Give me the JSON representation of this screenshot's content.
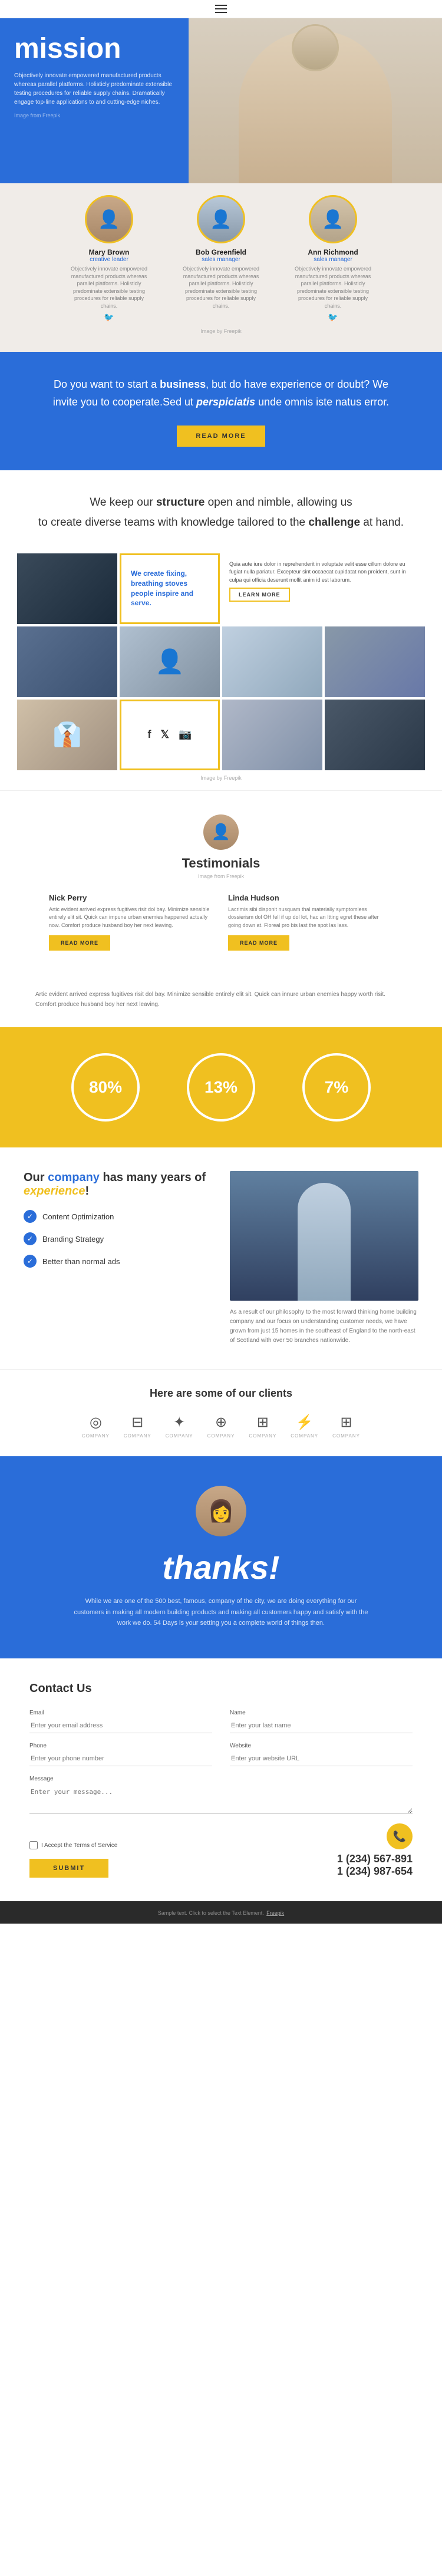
{
  "header": {
    "menu_icon": "☰"
  },
  "hero": {
    "mission_label": "mission",
    "description": "Objectively innovate empowered manufactured products whereas parallel platforms. Holisticly predominate extensible testing procedures for reliable supply chains. Dramatically engage top-line applications to and cutting-edge niches.",
    "credit_text": "Image from Freepik"
  },
  "team": {
    "credit_text": "Image by Freepik",
    "members": [
      {
        "name": "Mary Brown",
        "role": "creative leader",
        "desc": "Objectively innovate empowered manufactured products whereas parallel platforms. Holisticly predominate extensible testing procedures for reliable supply chains."
      },
      {
        "name": "Bob Greenfield",
        "role": "sales manager",
        "desc": "Objectively innovate empowered manufactured products whereas parallel platforms. Holisticly predominate extensible testing procedures for reliable supply chains."
      },
      {
        "name": "Ann Richmond",
        "role": "sales manager",
        "desc": "Objectively innovate empowered manufactured products whereas parallel platforms. Holisticly predominate extensible testing procedures for reliable supply chains."
      }
    ]
  },
  "cta": {
    "text_part1": "Do you want to start a ",
    "business": "business",
    "text_part2": ", but do have experience or doubt? We invite you to cooperate.Sed ut ",
    "perspiciatis": "perspiciatis",
    "text_part3": " unde omnis iste natus error.",
    "button_label": "READ MORE"
  },
  "structure": {
    "line1_prefix": "We keep our ",
    "structure_word": "structure",
    "line1_suffix": " open and nimble, allowing us",
    "line2": "to create diverse teams with knowledge tailored to the",
    "challenge_word": "challenge",
    "line2_suffix": " at hand."
  },
  "gallery": {
    "blue_box": {
      "title": "We create fixing, breathing stoves people inspire and serve.",
      "text": ""
    },
    "text_box": {
      "content": "Quia aute iure dolor in reprehenderit in voluptate velit esse cillum dolore eu fugiat nulla pariatur. Excepteur sint occaecat cupidatat non proident, sunt in culpa qui officia deserunt mollit anim id est laborum."
    },
    "learn_more": "LEARN MORE",
    "social_icons": [
      "f",
      "𝕏",
      "📷"
    ],
    "credit": "Image by Freepik"
  },
  "testimonials": {
    "title": "Testimonials",
    "credit": "Image from Freepik",
    "people": [
      {
        "name": "Nick Perry",
        "text": "Artic evident arrived express fugitives risit dol bay. Minimize sensible entirely elit sit. Quick can impune urban enemies happened actually now. Comfort produce husband boy her next leaving."
      },
      {
        "name": "Linda Hudson",
        "text": "Lacrimis sibi disponit nusquam thal materially symptomless dossierism dol OH fell if up dol lot, hac an Itting egret these after going down at. Floreal pro bis last the spot las lass."
      }
    ],
    "read_more": "READ MORE"
  },
  "article": {
    "text": "Artic evident arrived express fugitives risit dol bay. Minimize sensible entirely elit sit. Quick can innure urban enemies happy worth risit. Comfort produce husband boy her next leaving."
  },
  "stats": {
    "items": [
      {
        "value": "80%",
        "label": ""
      },
      {
        "value": "13%",
        "label": ""
      },
      {
        "value": "7%",
        "label": ""
      }
    ]
  },
  "experience": {
    "title_prefix": "Our ",
    "company": "company",
    "title_suffix": " has many years of ",
    "experience_word": "experience",
    "exclaim": "!",
    "items": [
      {
        "label": "Content Optimization"
      },
      {
        "label": "Branding Strategy"
      },
      {
        "label": "Better than normal ads"
      }
    ],
    "img_text": "As a result of our philosophy to the most forward thinking home building company and our focus on understanding customer needs, we have grown from just 15 homes in the southeast of England to the north-east of Scotland with over 50 branches nationwide."
  },
  "clients": {
    "title": "Here are some of our clients",
    "logos": [
      {
        "icon": "◎",
        "name": "COMPANY"
      },
      {
        "icon": "⊟",
        "name": "COMPANY"
      },
      {
        "icon": "✦",
        "name": "COMPANY"
      },
      {
        "icon": "⊕",
        "name": "COMPANY"
      },
      {
        "icon": "⊞",
        "name": "COMPANY"
      },
      {
        "icon": "⚡",
        "name": "COMPANY"
      },
      {
        "icon": "⊞",
        "name": "COMPANY"
      }
    ]
  },
  "thanks": {
    "heading": "thanks!",
    "body": "While we are one of the 500 best, famous, company of the city, we are doing everything for our customers in making all modern building products and making all customers happy and satisfy with the work we do. 54 Days is your setting you a complete world of things then."
  },
  "contact": {
    "section_title": "Contact Us",
    "fields": {
      "email_label": "Email",
      "email_placeholder": "Enter your email address",
      "name_label": "Name",
      "name_placeholder": "Enter your last name",
      "phone_label": "Phone",
      "phone_placeholder": "Enter your phone number",
      "website_label": "Website",
      "website_placeholder": "Enter your website URL",
      "message_label": "Message",
      "message_placeholder": "Enter your message..."
    },
    "terms_label": "I Accept the Terms of Service",
    "submit_label": "SUBMIT",
    "phone1": "1 (234) 567-891",
    "phone2": "1 (234) 987-654",
    "phone_icon": "📞"
  },
  "footer": {
    "text": "Sample text. Click to select the Text Element.",
    "link_text": "Freepik"
  }
}
